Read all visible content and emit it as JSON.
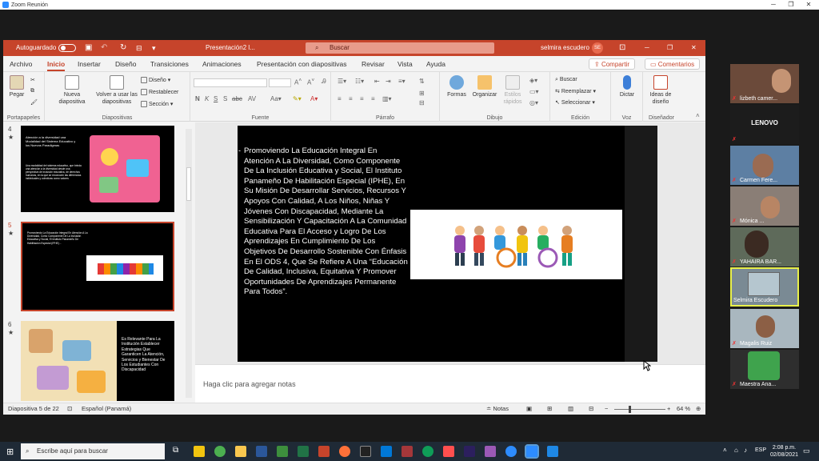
{
  "zoom": {
    "title": "Zoom Reunión"
  },
  "ppt": {
    "autosave_label": "Autoguardado",
    "doc_title": "Presentación2 l...",
    "search_label": "Buscar",
    "user": "selmira escudero",
    "user_initials": "SE",
    "tabs": [
      "Archivo",
      "Inicio",
      "Insertar",
      "Diseño",
      "Transiciones",
      "Animaciones",
      "Presentación con diapositivas",
      "Revisar",
      "Vista",
      "Ayuda"
    ],
    "share_label": "Compartir",
    "comments_label": "Comentarios",
    "ribbon": {
      "paste": "Pegar",
      "new_slide": "Nueva diapositiva",
      "reuse": "Volver a usar las diapositivas",
      "layout": "Diseño",
      "reset": "Restablecer",
      "section": "Sección",
      "shapes": "Formas",
      "arrange": "Organizar",
      "quick_styles": "Estilos rápidos",
      "find": "Buscar",
      "replace": "Reemplazar",
      "select": "Seleccionar",
      "dictate": "Dictar",
      "designer": "Ideas de diseño",
      "groups": {
        "clipboard": "Portapapeles",
        "slides": "Diapositivas",
        "font": "Fuente",
        "paragraph": "Párrafo",
        "drawing": "Dibujo",
        "editing": "Edición",
        "voice": "Voz",
        "designer": "Diseñador"
      }
    },
    "thumbs": {
      "n4": "4",
      "n5": "5",
      "n6": "6",
      "t4_title": "Atención a la diversidad una Modalidad del Sistema Educativo y los Nuevos Paradigmas",
      "t4_body": "Una modalidad del sistema educativo, que brinda una atención a la diversidad desde una perspectiva de inclusión educativa, de derechos humanos, en la que se reconocen las diferencias individuales y colectivas como valores",
      "t5_body": "Promoviendo La Educación Integral En Atención A La Diversidad, Como Componente De La Inclusión Educativa y Social, El Instituto Panameño De Habilitación Especial (IPHE)...",
      "t6_body": "Es Relevante Para La Institución Establecer Estrategias Que Garanticen La Atención, Servicios y Bienestar De Los Estudiantes Con Discapacidad"
    },
    "slide_text": "Promoviendo La Educación Integral En Atención A La Diversidad, Como Componente De La Inclusión Educativa y Social, El Instituto Panameño De Habilitación Especial (IPHE), En Su Misión De Desarrollar Servicios, Recursos Y Apoyos Con Calidad, A Los Niños, Niñas Y Jóvenes Con Discapacidad, Mediante La Sensibilización Y Capacitación A La Comunidad Educativa Para El Acceso y Logro De Los Aprendizajes En Cumplimiento De Los Objetivos De Desarrollo Sostenible Con Énfasis En El ODS 4, Que Se Refiere A Una “Educación De Calidad, Inclusiva, Equitativa Y Promover Oportunidades De Aprendizajes Permanente Para Todos”.",
    "notes_placeholder": "Haga clic para agregar notas",
    "status": {
      "slide": "Diapositiva 5 de 22",
      "lang": "Español (Panamá)",
      "notes": "Notas",
      "zoom": "64 %"
    }
  },
  "participants": [
    {
      "name": "lizbeth camer..."
    },
    {
      "name": "LENOVO"
    },
    {
      "name": "Carmen Fere..."
    },
    {
      "name": "Mónica ..."
    },
    {
      "name": "YAHAIRA BAR..."
    },
    {
      "name": "Selmira Escudero"
    },
    {
      "name": "Magalis Ruiz"
    },
    {
      "name": "Maestra Ana..."
    }
  ],
  "taskbar": {
    "search_placeholder": "Escribe aquí para buscar",
    "lang": "ESP",
    "time": "2:08 p.m.",
    "date": "02/08/2021"
  },
  "colors": {
    "ppt_accent": "#c6442b",
    "active_speaker": "#e8f04a"
  }
}
